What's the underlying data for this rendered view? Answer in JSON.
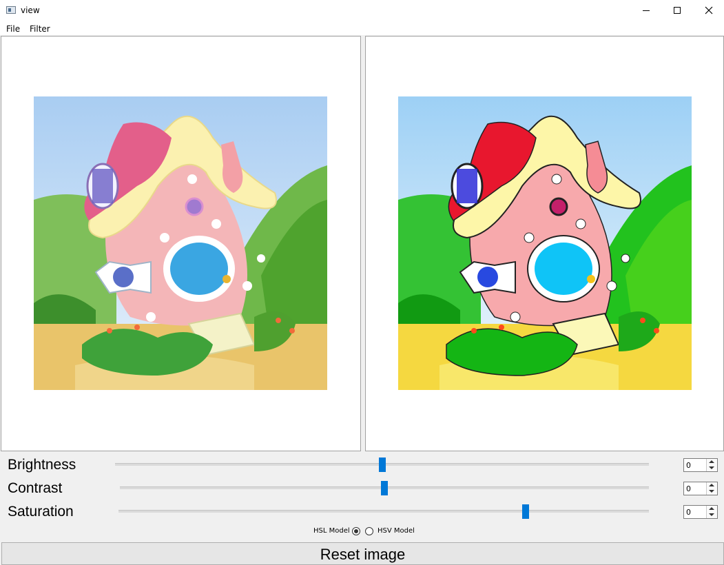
{
  "window": {
    "title": "view"
  },
  "menu": [
    "File",
    "Filter"
  ],
  "images": {
    "original": "house illustration (original)",
    "filtered": "house illustration (filtered, high contrast)"
  },
  "sliders": [
    {
      "label": "Brightness",
      "value": "0",
      "position_fraction": 0.5
    },
    {
      "label": "Contrast",
      "value": "0",
      "position_fraction": 0.5
    },
    {
      "label": "Saturation",
      "value": "0",
      "position_fraction": 0.77
    }
  ],
  "color_model": {
    "hsl_label": "HSL Model",
    "hsv_label": "HSV Model",
    "selected": "HSL Model"
  },
  "reset_label": "Reset image",
  "colors": {
    "accent": "#0078d7",
    "background": "#f0f0f0"
  }
}
